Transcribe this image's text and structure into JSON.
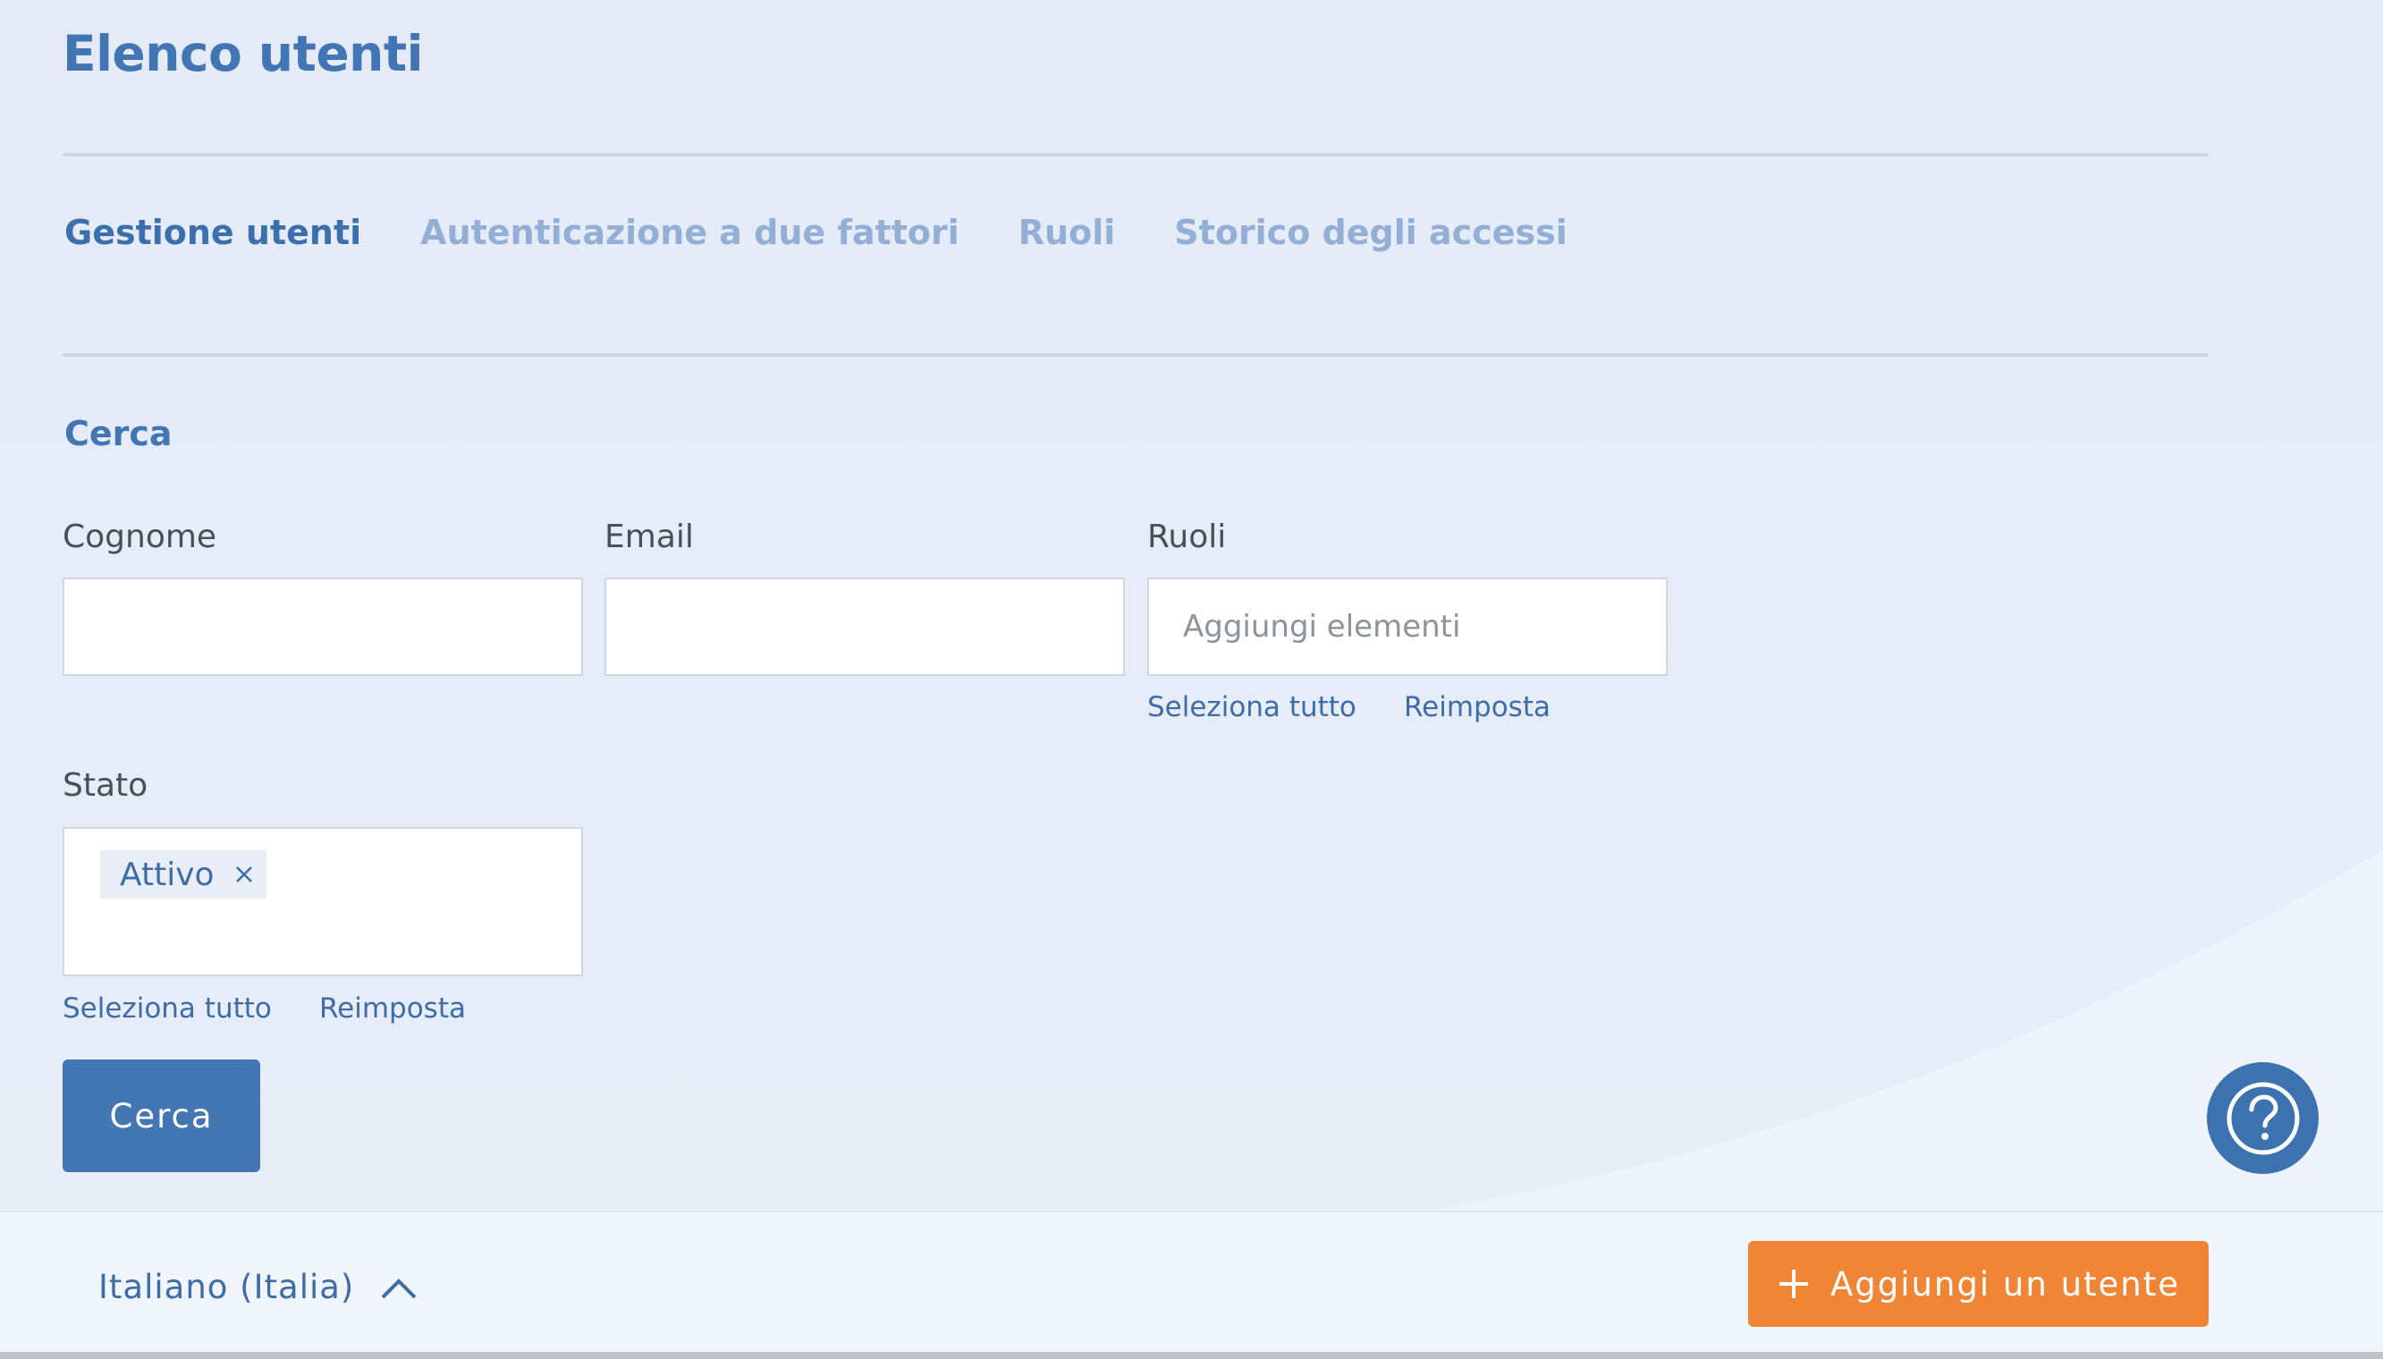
{
  "page": {
    "title": "Elenco utenti"
  },
  "tabs": [
    {
      "label": "Gestione utenti",
      "active": true
    },
    {
      "label": "Autenticazione a due fattori",
      "active": false
    },
    {
      "label": "Ruoli",
      "active": false
    },
    {
      "label": "Storico degli accessi",
      "active": false
    }
  ],
  "search": {
    "section_title": "Cerca",
    "fields": {
      "surname": {
        "label": "Cognome",
        "value": ""
      },
      "email": {
        "label": "Email",
        "value": ""
      },
      "roles": {
        "label": "Ruoli",
        "placeholder": "Aggiungi elementi",
        "select_all": "Seleziona tutto",
        "reset": "Reimposta"
      },
      "status": {
        "label": "Stato",
        "selected": [
          "Attivo"
        ],
        "select_all": "Seleziona tutto",
        "reset": "Reimposta"
      }
    },
    "submit_label": "Cerca"
  },
  "footer": {
    "language": "Italiano (Italia)",
    "add_user_label": "Aggiungi un utente"
  },
  "icons": {
    "help": "question-circle-icon",
    "language_toggle": "chevron-up-icon",
    "add": "plus-icon",
    "chip_remove": "close-icon"
  },
  "colors": {
    "primary": "#4377b3",
    "accent_orange": "#ef8535",
    "tab_inactive": "#93afd6",
    "background": "#e6edf7"
  }
}
